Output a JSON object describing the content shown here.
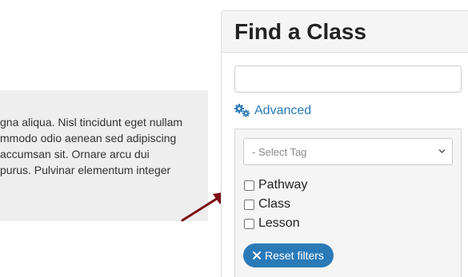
{
  "content": {
    "lines": [
      "gna aliqua. Nisl tincidunt eget nullam",
      "mmodo odio aenean sed adipiscing",
      "accumsan sit. Ornare arcu dui",
      "purus. Pulvinar elementum integer"
    ]
  },
  "sidebar": {
    "title": "Find a Class",
    "search": {
      "value": "",
      "placeholder": ""
    },
    "advanced_label": "Advanced",
    "filters": {
      "tag_select": {
        "selected": "- Select Tag"
      },
      "checkboxes": [
        {
          "label": "Pathway",
          "checked": false
        },
        {
          "label": "Class",
          "checked": false
        },
        {
          "label": "Lesson",
          "checked": false
        }
      ],
      "reset_label": "Reset filters"
    }
  },
  "colors": {
    "accent": "#2a7ab8",
    "arrow": "#7a0e14",
    "panel_bg": "#f5f5f5",
    "content_bg": "#eeeeee"
  },
  "icons": {
    "advanced": "gears-icon",
    "select": "chevron-down-icon",
    "reset": "close-icon",
    "annotation": "arrow-icon"
  }
}
